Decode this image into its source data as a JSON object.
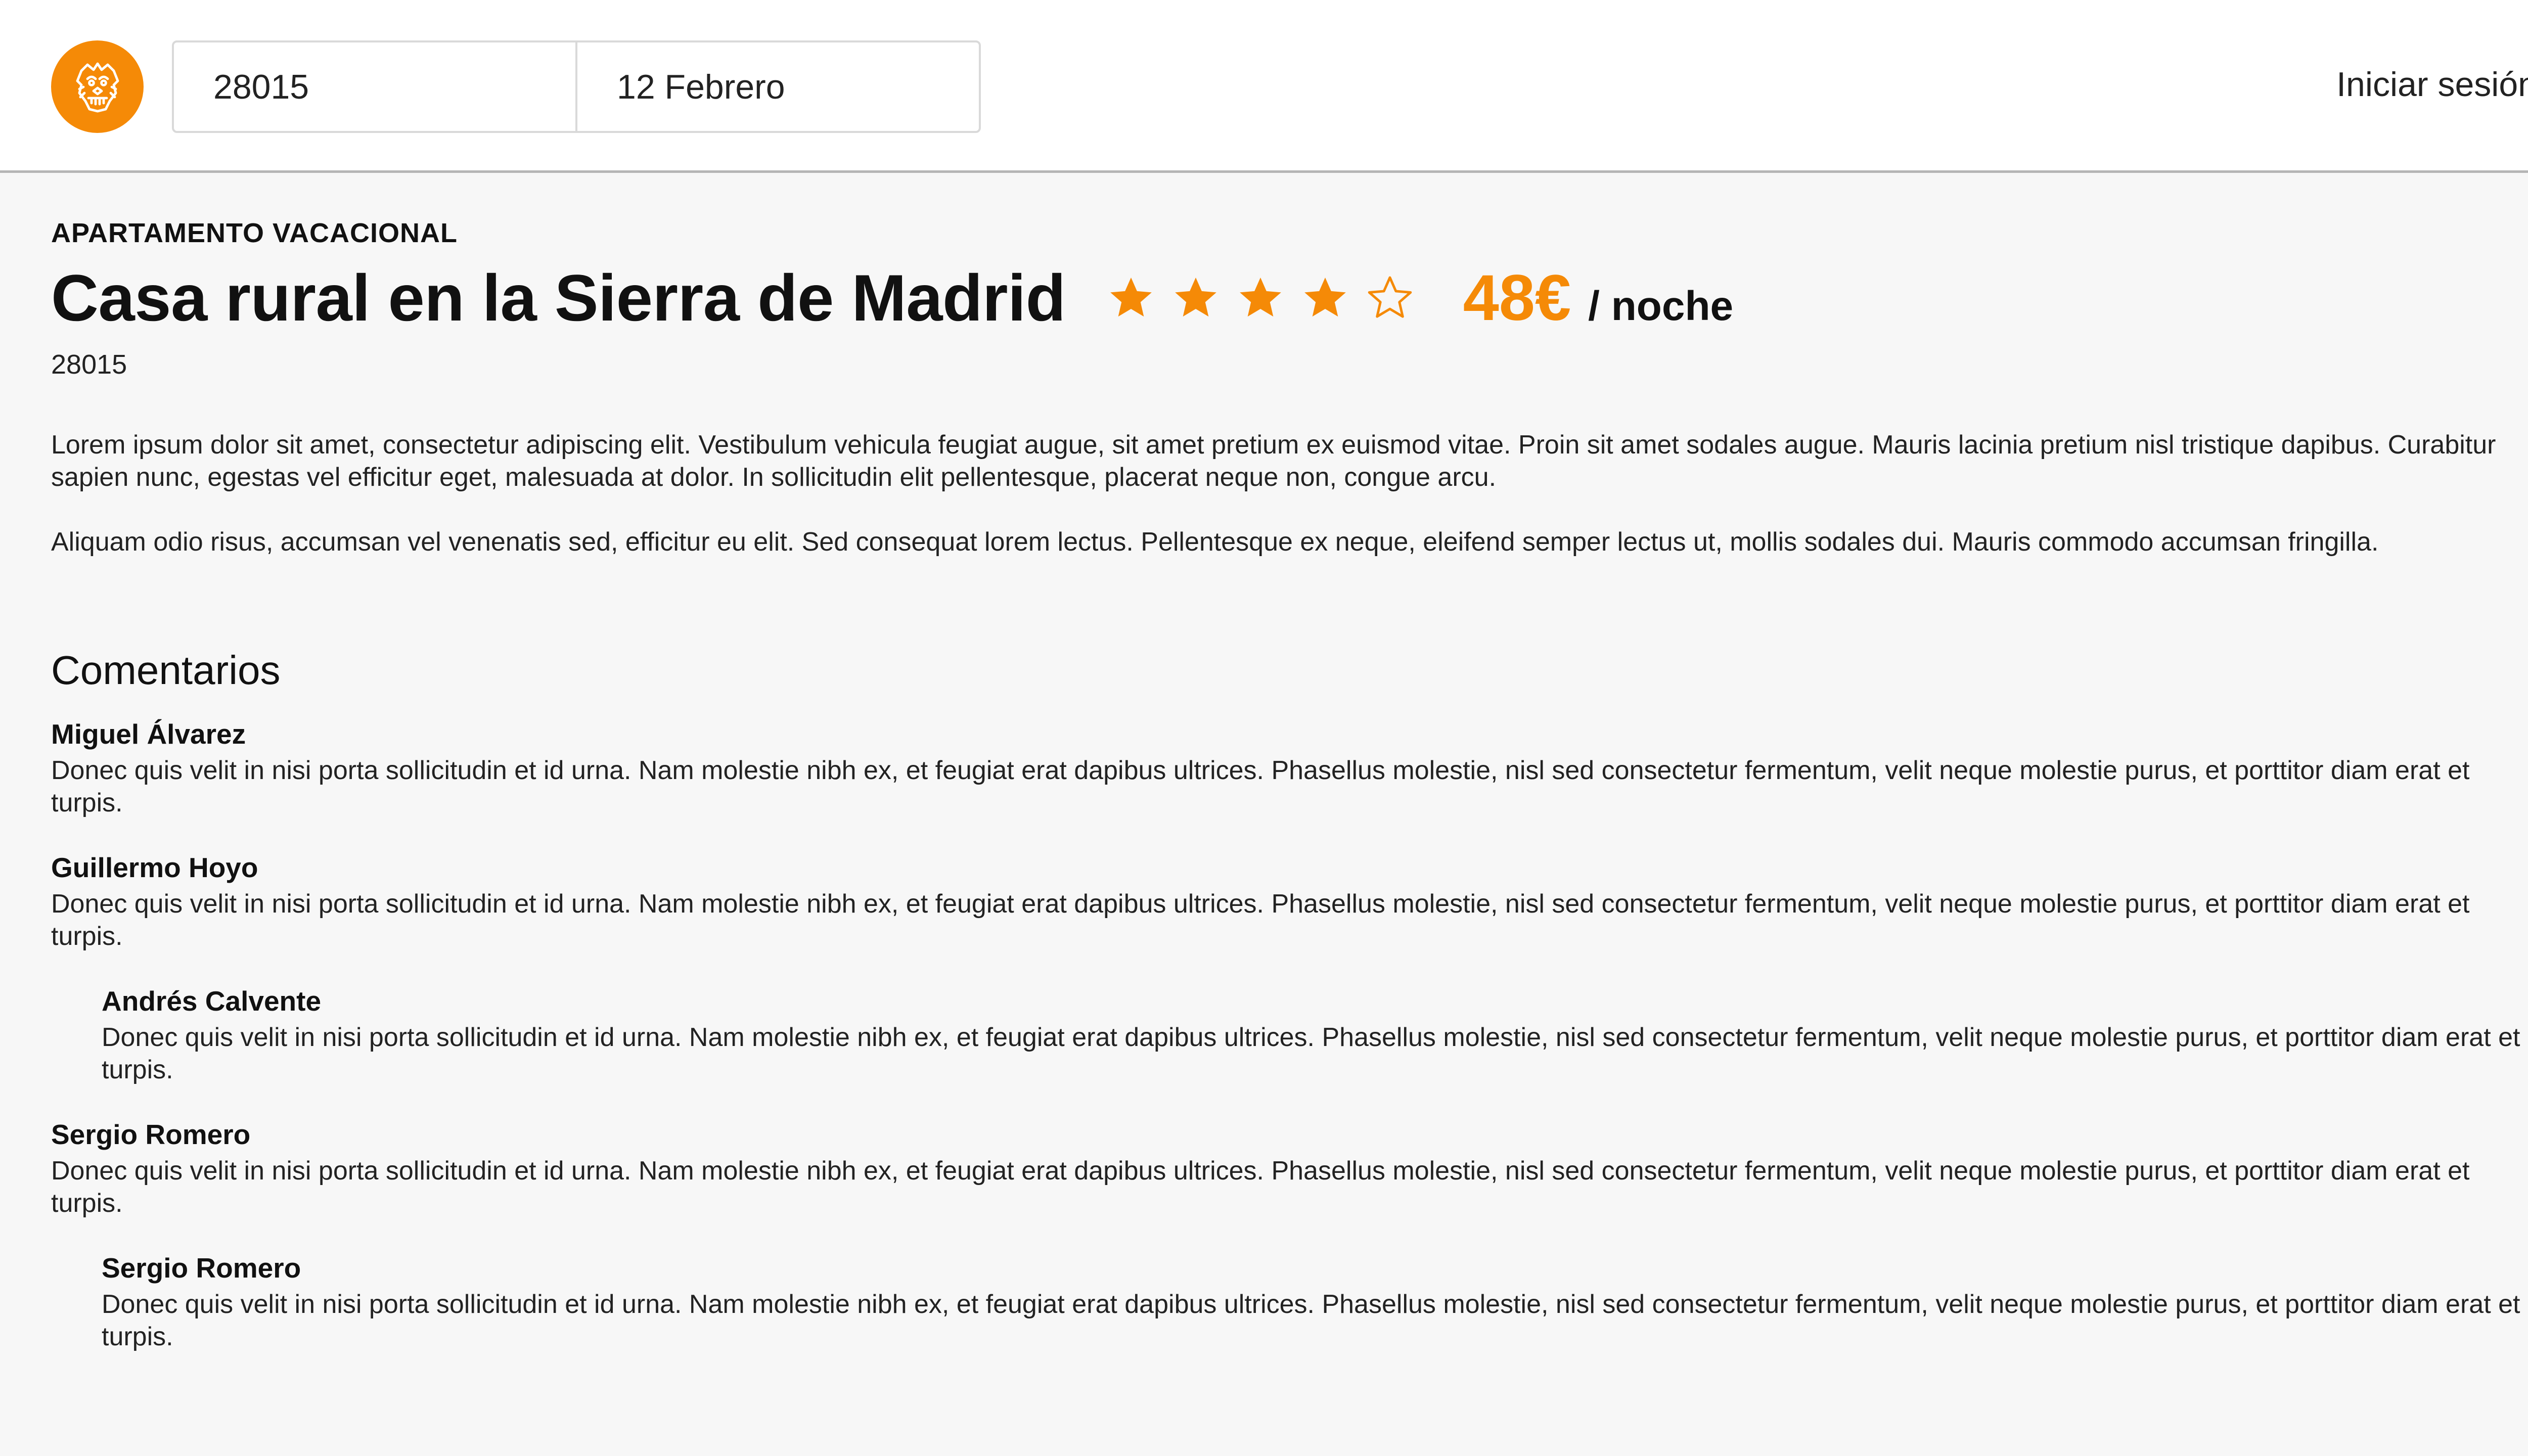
{
  "header": {
    "search_location": "28015",
    "search_date": "12 Febrero",
    "login_label": "Iniciar sesión"
  },
  "listing": {
    "type": "APARTAMENTO VACACIONAL",
    "title": "Casa rural en la Sierra de Madrid",
    "rating": 4,
    "rating_max": 5,
    "price": "48€",
    "price_unit": "/ noche",
    "postcode": "28015",
    "description": [
      "Lorem ipsum dolor sit amet, consectetur adipiscing elit. Vestibulum vehicula feugiat augue, sit amet pretium ex euismod vitae. Proin sit amet sodales augue. Mauris lacinia pretium nisl tristique dapibus. Curabitur sapien nunc, egestas vel efficitur eget, malesuada at dolor. In sollicitudin elit pellentesque, placerat neque non, congue arcu.",
      "Aliquam odio risus, accumsan vel venenatis sed, efficitur eu elit. Sed consequat lorem lectus. Pellentesque ex neque, eleifend semper lectus ut, mollis sodales dui. Mauris commodo accumsan fringilla."
    ]
  },
  "comments": {
    "heading": "Comentarios",
    "items": [
      {
        "author": "Miguel Álvarez",
        "text": "Donec quis velit in nisi porta sollicitudin et id urna. Nam molestie nibh ex, et feugiat erat dapibus ultrices. Phasellus molestie, nisl sed consectetur fermentum, velit neque molestie purus, et porttitor diam erat et turpis."
      },
      {
        "author": "Guillermo Hoyo",
        "text": "Donec quis velit in nisi porta sollicitudin et id urna. Nam molestie nibh ex, et feugiat erat dapibus ultrices. Phasellus molestie, nisl sed consectetur fermentum, velit neque molestie purus, et porttitor diam erat et turpis."
      },
      {
        "author": "Andrés Calvente",
        "text": "Donec quis velit in nisi porta sollicitudin et id urna. Nam molestie nibh ex, et feugiat erat dapibus ultrices. Phasellus molestie, nisl sed consectetur fermentum, velit neque molestie purus, et porttitor diam erat et turpis."
      },
      {
        "author": "Sergio Romero",
        "text": "Donec quis velit in nisi porta sollicitudin et id urna. Nam molestie nibh ex, et feugiat erat dapibus ultrices. Phasellus molestie, nisl sed consectetur fermentum, velit neque molestie purus, et porttitor diam erat et turpis."
      },
      {
        "author": "Sergio Romero",
        "text": "Donec quis velit in nisi porta sollicitudin et id urna. Nam molestie nibh ex, et feugiat erat dapibus ultrices. Phasellus molestie, nisl sed consectetur fermentum, velit neque molestie purus, et porttitor diam erat et turpis."
      }
    ]
  },
  "colors": {
    "accent": "#f58a07",
    "header_bg": "#ffffff",
    "page_bg": "#f7f7f7"
  },
  "icons": {
    "logo": "lion-mask-logo-icon",
    "star_filled": "star-filled-icon",
    "star_empty": "star-outline-icon"
  }
}
